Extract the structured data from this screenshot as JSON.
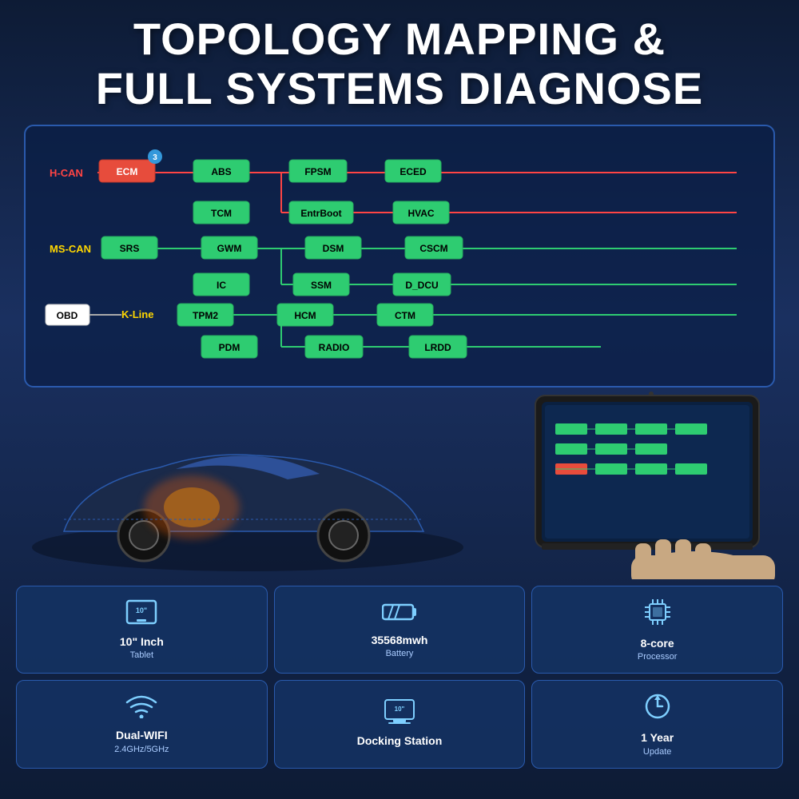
{
  "header": {
    "title_line1": "TOPOLOGY MAPPING &",
    "title_line2": "FULL SYSTEMS DIAGNOSE"
  },
  "topology": {
    "buses": {
      "hcan": "H-CAN",
      "mscan": "MS-CAN",
      "kline": "K-Line",
      "obd": "OBD"
    },
    "nodes": {
      "ecm": "ECM",
      "ecm_badge": "3",
      "abs": "ABS",
      "fpsm": "FPSM",
      "eced": "ECED",
      "tcm": "TCM",
      "entrboot": "EntrBoot",
      "hvac": "HVAC",
      "srs": "SRS",
      "gwm": "GWM",
      "dsm": "DSM",
      "cscm": "CSCM",
      "ic": "IC",
      "ssm": "SSM",
      "d_dcu": "D_DCU",
      "tpm2": "TPM2",
      "hcm": "HCM",
      "ctm": "CTM",
      "pdm": "PDM",
      "radio": "RADIO",
      "lrdd": "LRDD"
    }
  },
  "features": [
    {
      "id": "tablet-size",
      "icon": "tablet",
      "label": "10\" Inch",
      "sublabel": "Tablet"
    },
    {
      "id": "battery",
      "icon": "battery",
      "label": "35568mwh",
      "sublabel": "Battery"
    },
    {
      "id": "processor",
      "icon": "chip",
      "label": "8-core",
      "sublabel": "Processor"
    },
    {
      "id": "wifi",
      "icon": "wifi",
      "label": "Dual-WIFI",
      "sublabel": "2.4GHz/5GHz"
    },
    {
      "id": "docking",
      "icon": "docking",
      "label": "Docking Station",
      "sublabel": ""
    },
    {
      "id": "update",
      "icon": "update",
      "label": "1 Year",
      "sublabel": "Update"
    }
  ],
  "colors": {
    "background": "#0d1b35",
    "panel_border": "#2a5aad",
    "node_green": "#2ecc71",
    "node_red": "#e74c3c",
    "hcan_line": "#ff4444",
    "bus_label_yellow": "#ffd700",
    "accent_blue": "#7ecfff"
  }
}
